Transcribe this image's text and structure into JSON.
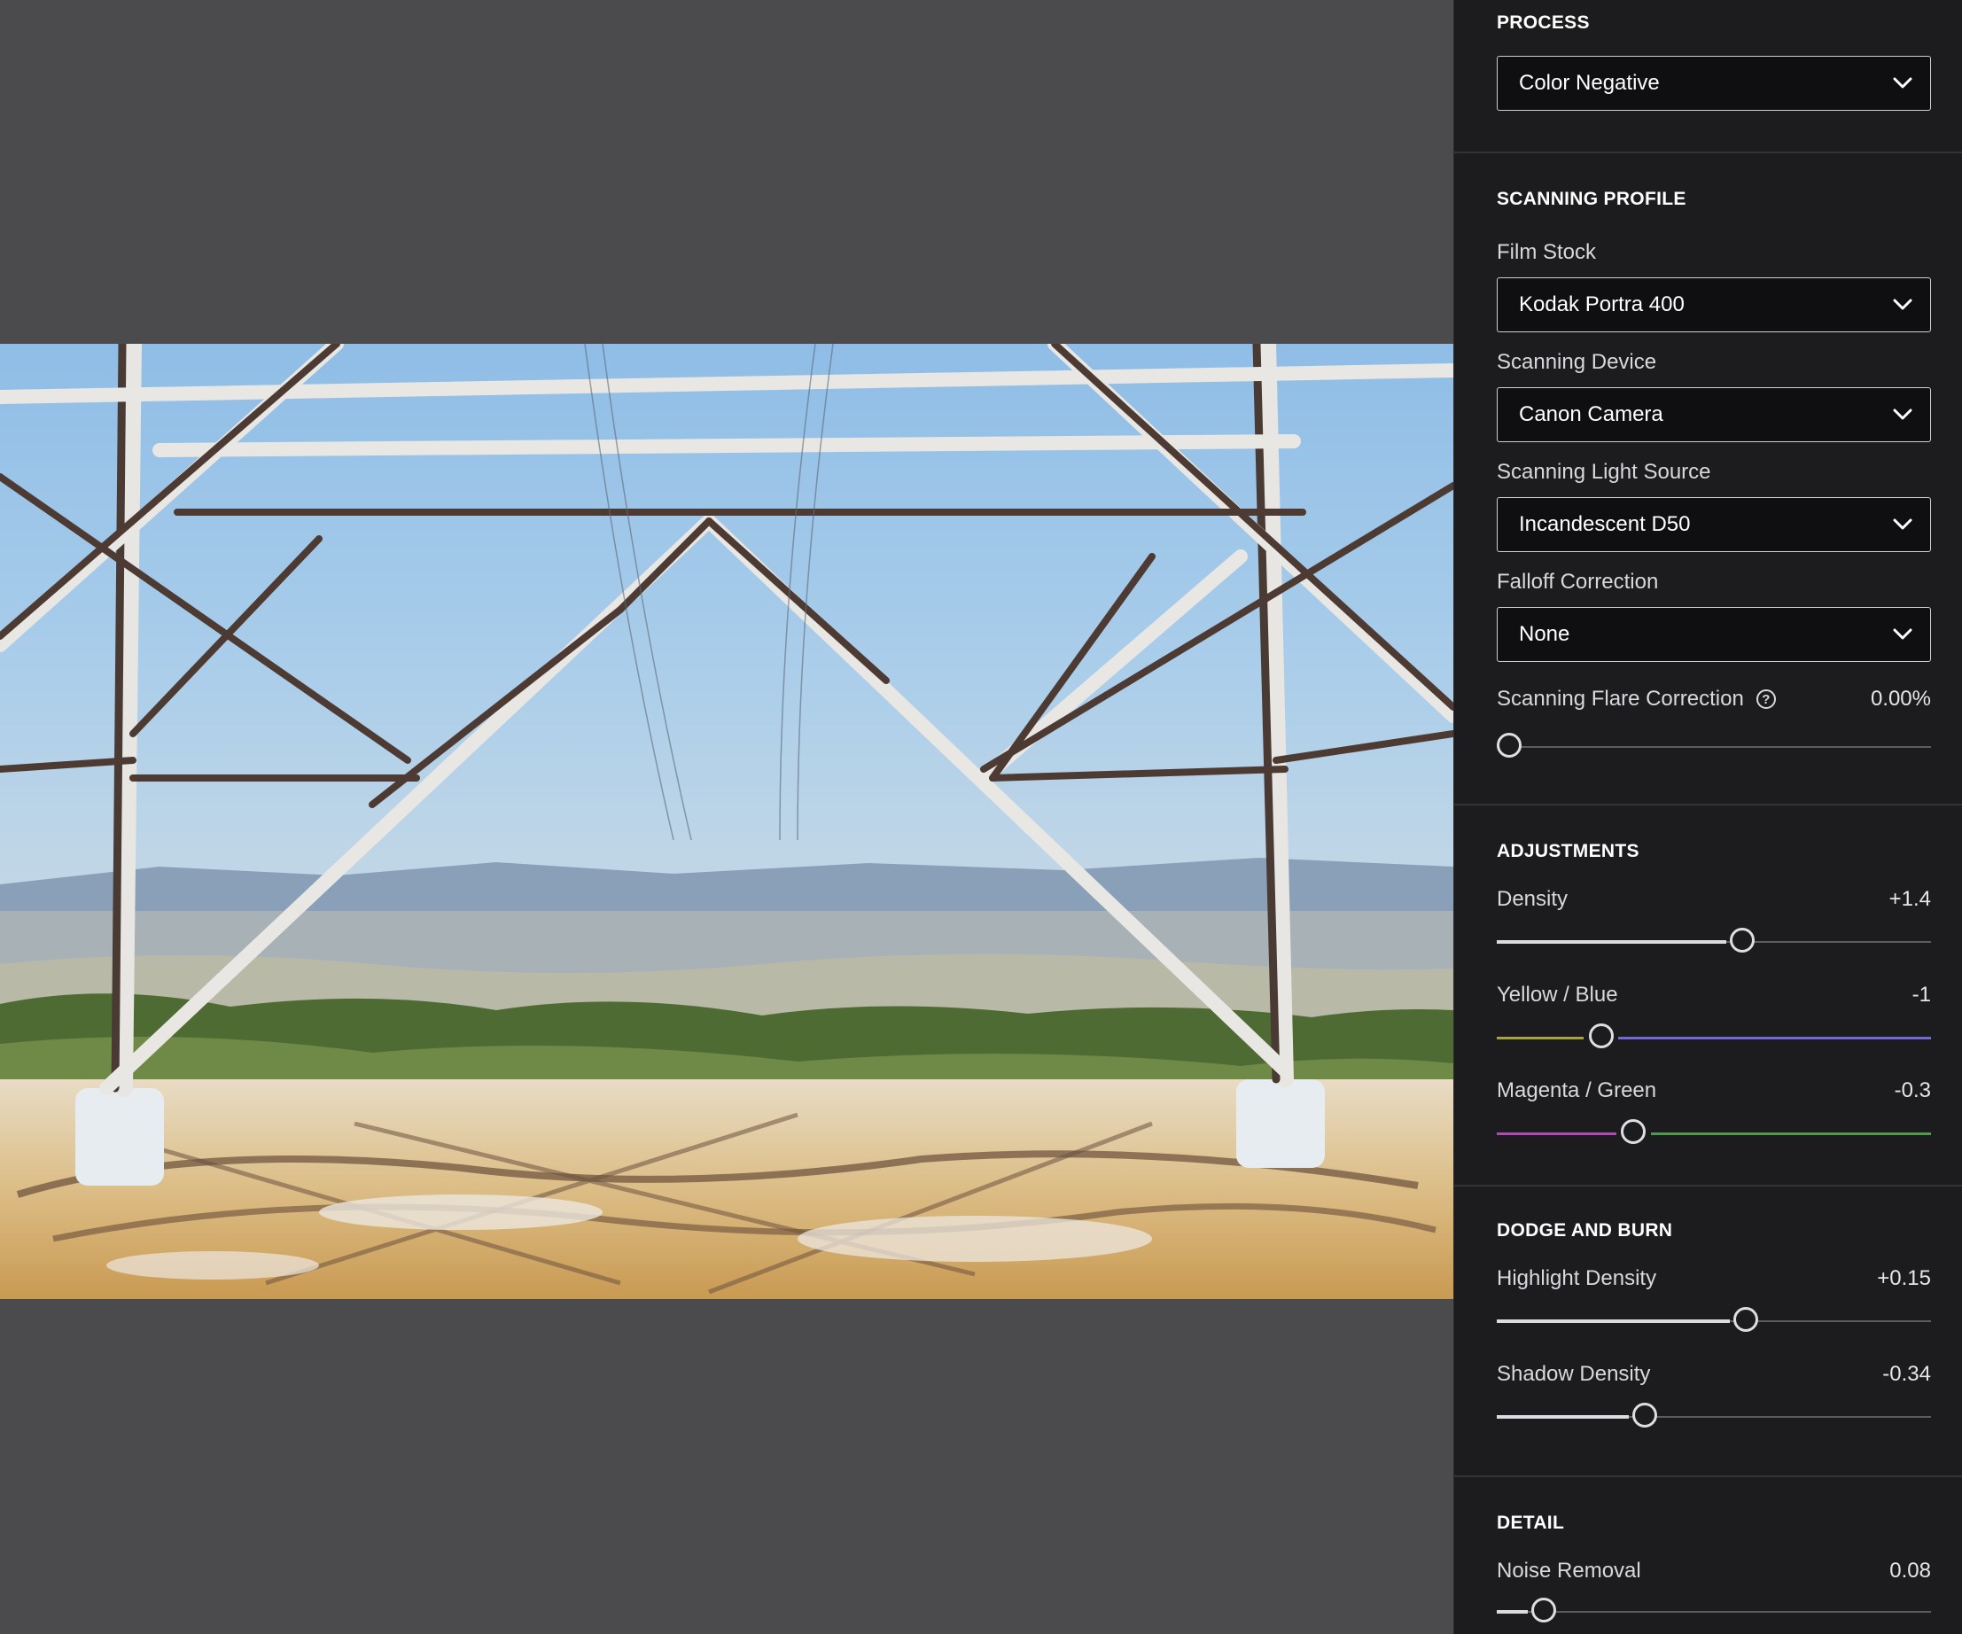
{
  "process": {
    "title": "PROCESS",
    "value": "Color Negative"
  },
  "scanning_profile": {
    "title": "SCANNING PROFILE",
    "film_stock": {
      "label": "Film Stock",
      "value": "Kodak Portra 400"
    },
    "scanning_device": {
      "label": "Scanning Device",
      "value": "Canon Camera"
    },
    "light_source": {
      "label": "Scanning Light Source",
      "value": "Incandescent D50"
    },
    "falloff": {
      "label": "Falloff Correction",
      "value": "None"
    },
    "flare": {
      "label": "Scanning Flare Correction",
      "value": "0.00%",
      "position": 0.0
    }
  },
  "adjustments": {
    "title": "ADJUSTMENTS",
    "density": {
      "label": "Density",
      "value": "+1.4",
      "position": 0.565
    },
    "yellow_blue": {
      "label": "Yellow / Blue",
      "value": "-1",
      "position": 0.24,
      "colors": [
        "#a8a43c",
        "#6f6ad6"
      ]
    },
    "magenta_green": {
      "label": "Magenta / Green",
      "value": "-0.3",
      "position": 0.315,
      "colors": [
        "#b049b6",
        "#4f9a4b"
      ]
    }
  },
  "dodge_burn": {
    "title": "DODGE AND BURN",
    "highlight": {
      "label": "Highlight Density",
      "value": "+0.15",
      "position": 0.573
    },
    "shadow": {
      "label": "Shadow Density",
      "value": "-0.34",
      "position": 0.341
    }
  },
  "detail": {
    "title": "DETAIL",
    "noise": {
      "label": "Noise Removal",
      "value": "0.08",
      "position": 0.108
    }
  },
  "icons": {
    "chevron": "chevron-down-icon",
    "help": "help-circle-icon"
  }
}
